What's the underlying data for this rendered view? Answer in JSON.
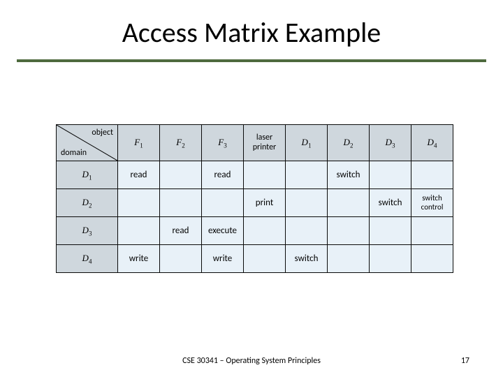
{
  "title": "Access Matrix Example",
  "corner": {
    "object": "object",
    "domain": "domain"
  },
  "col_headers": {
    "F1": "F",
    "F1sub": "1",
    "F2": "F",
    "F2sub": "2",
    "F3": "F",
    "F3sub": "3",
    "LP": "laser printer",
    "D1": "D",
    "D1sub": "1",
    "D2": "D",
    "D2sub": "2",
    "D3": "D",
    "D3sub": "3",
    "D4": "D",
    "D4sub": "4"
  },
  "row_headers": {
    "D1": "D",
    "D1sub": "1",
    "D2": "D",
    "D2sub": "2",
    "D3": "D",
    "D3sub": "3",
    "D4": "D",
    "D4sub": "4"
  },
  "cells": {
    "r1c1": "read",
    "r1c2": "",
    "r1c3": "read",
    "r1c4": "",
    "r1c5": "",
    "r1c6": "switch",
    "r1c7": "",
    "r1c8": "",
    "r2c1": "",
    "r2c2": "",
    "r2c3": "",
    "r2c4": "print",
    "r2c5": "",
    "r2c6": "",
    "r2c7": "switch",
    "r2c8": "switch control",
    "r3c1": "",
    "r3c2": "read",
    "r3c3": "execute",
    "r3c4": "",
    "r3c5": "",
    "r3c6": "",
    "r3c7": "",
    "r3c8": "",
    "r4c1": "write",
    "r4c2": "",
    "r4c3": "write",
    "r4c4": "",
    "r4c5": "switch",
    "r4c6": "",
    "r4c7": "",
    "r4c8": ""
  },
  "footer": {
    "course": "CSE 30341 – Operating System Principles",
    "page": "17"
  },
  "chart_data": {
    "type": "table",
    "title": "Access Matrix Example",
    "row_label": "domain",
    "col_label": "object",
    "columns": [
      "F1",
      "F2",
      "F3",
      "laser printer",
      "D1",
      "D2",
      "D3",
      "D4"
    ],
    "rows": [
      "D1",
      "D2",
      "D3",
      "D4"
    ],
    "matrix": [
      [
        "read",
        "",
        "read",
        "",
        "",
        "switch",
        "",
        ""
      ],
      [
        "",
        "",
        "",
        "print",
        "",
        "",
        "switch",
        "switch control"
      ],
      [
        "",
        "read",
        "execute",
        "",
        "",
        "",
        "",
        ""
      ],
      [
        "write",
        "",
        "write",
        "",
        "switch",
        "",
        "",
        ""
      ]
    ]
  }
}
